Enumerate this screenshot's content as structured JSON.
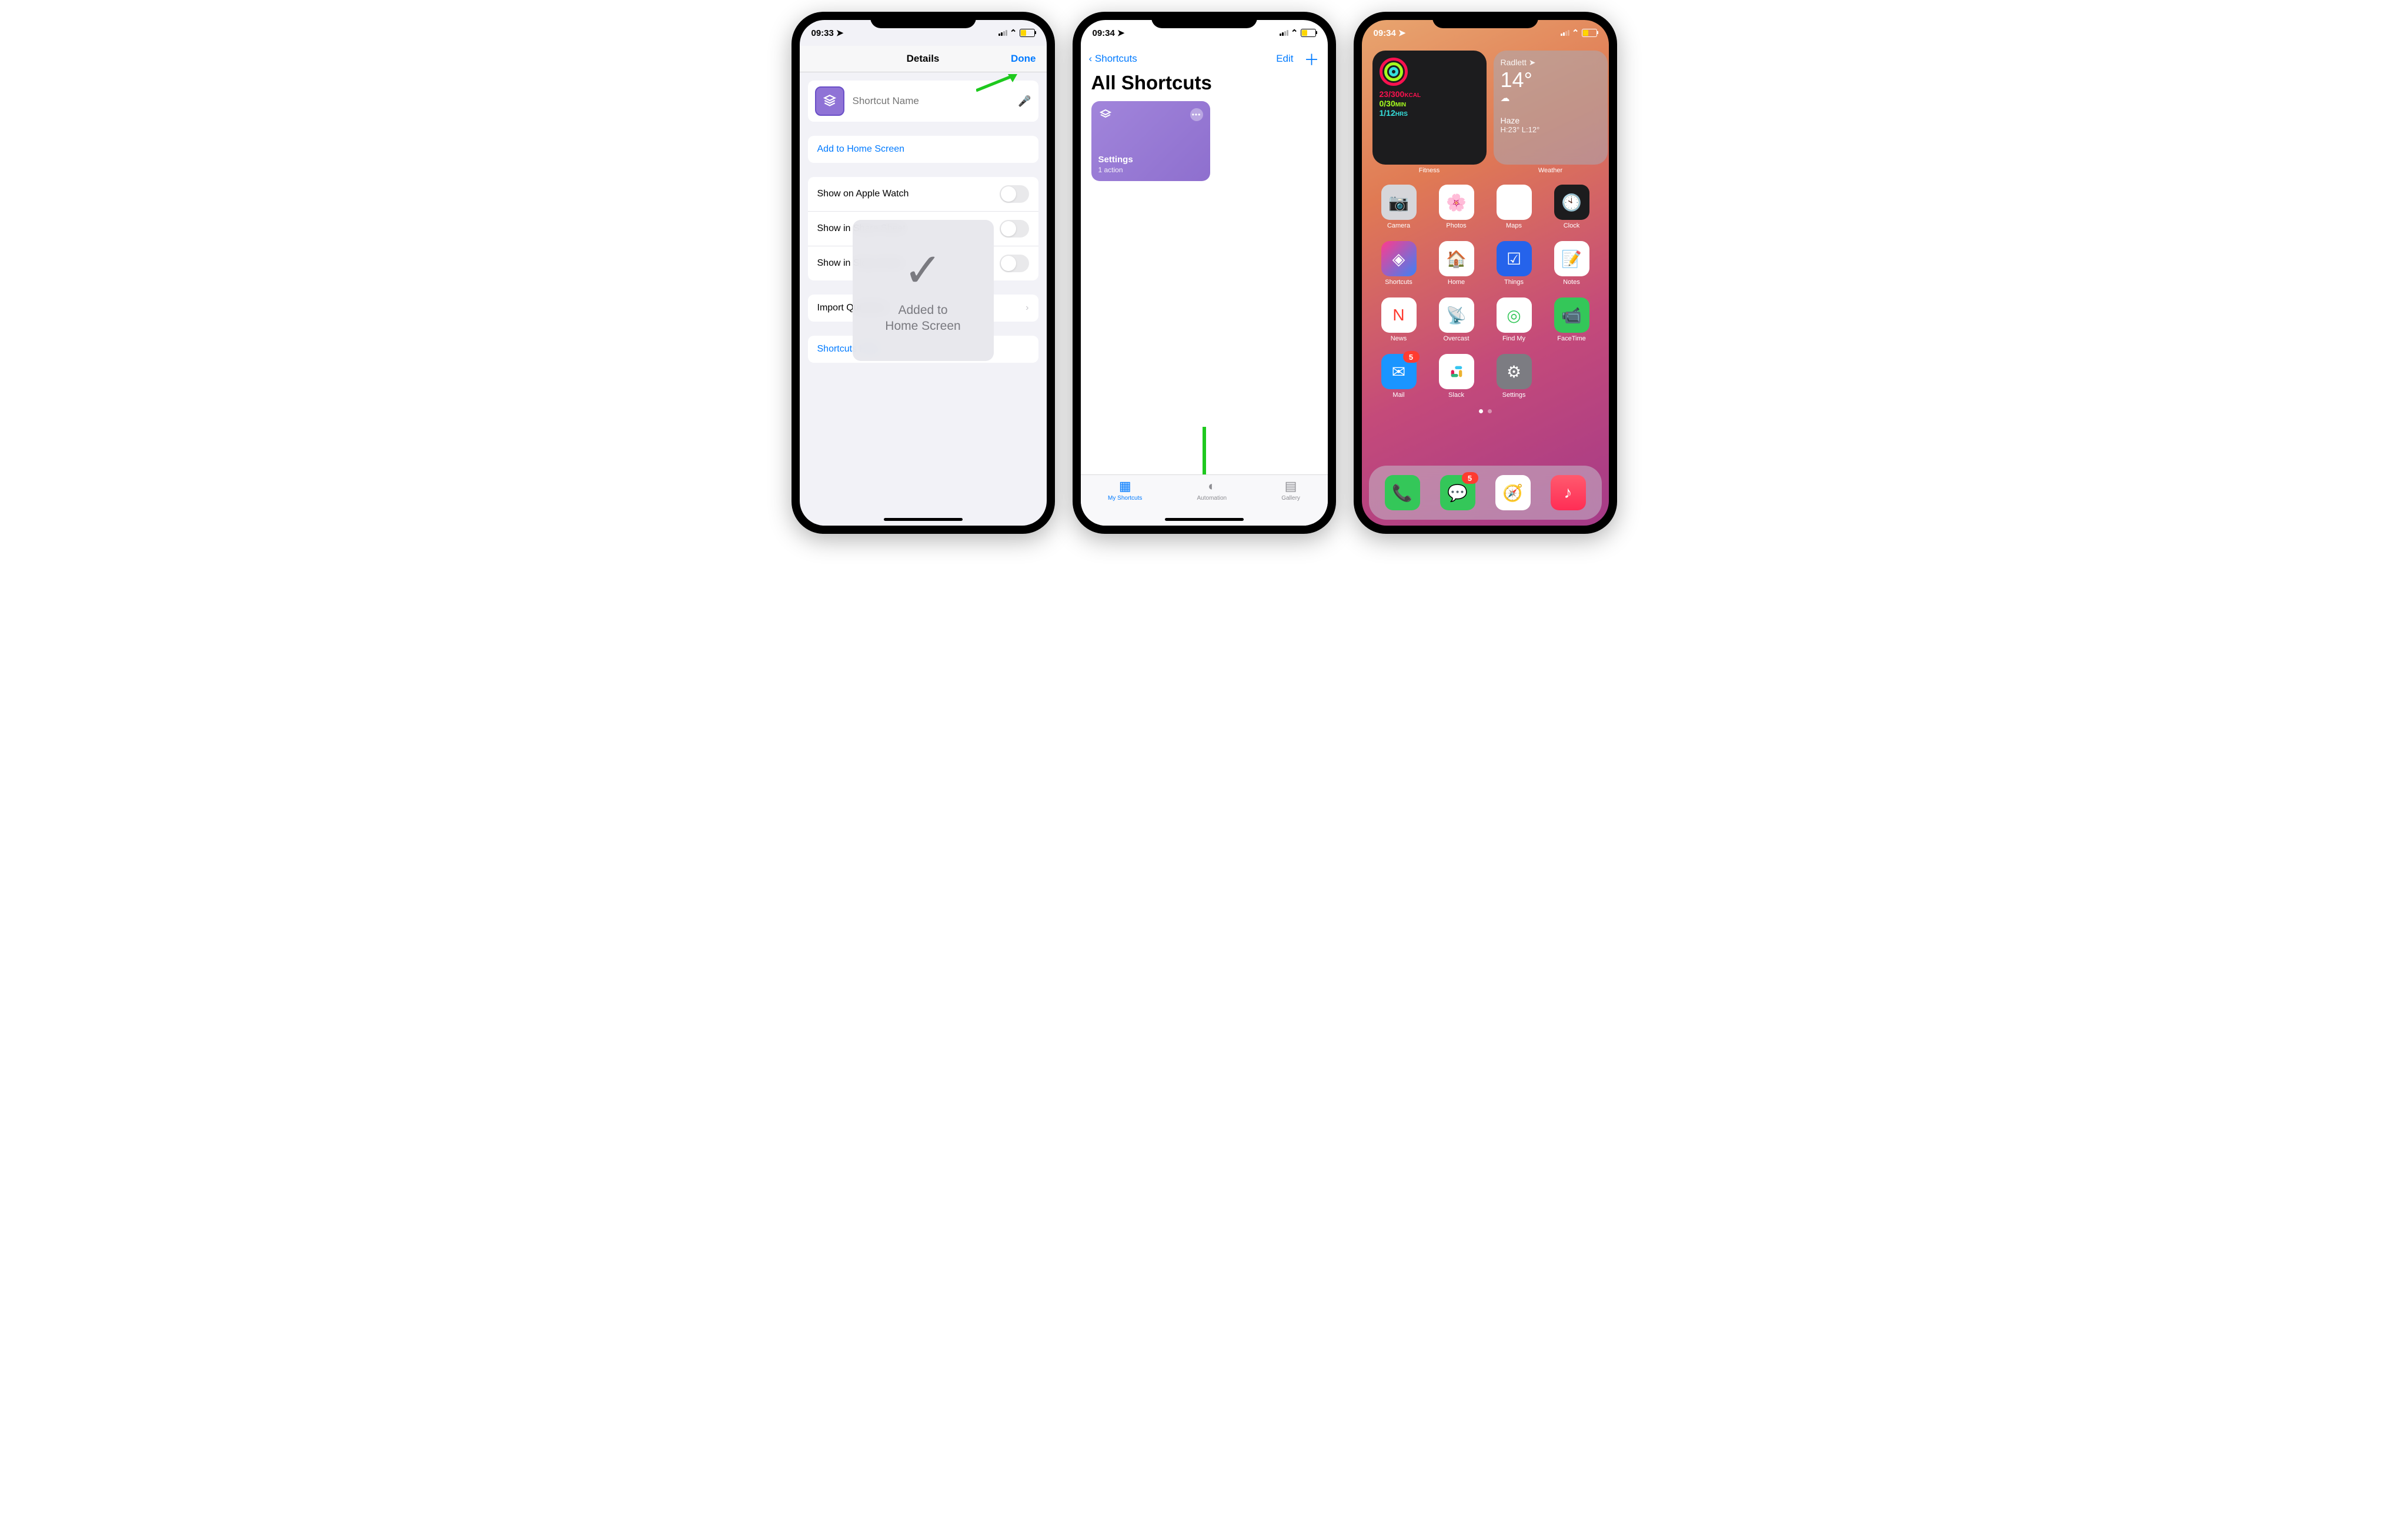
{
  "screen1": {
    "status_time": "09:33",
    "nav_title": "Details",
    "nav_done": "Done",
    "name_placeholder": "Shortcut Name",
    "add_home": "Add to Home Screen",
    "show_watch": "Show on Apple Watch",
    "show_share": "Show in Share Sheet",
    "show_sleep": "Show in Sleep Mode",
    "import_q": "Import Questions",
    "help": "Shortcuts Help",
    "toast_line1": "Added to",
    "toast_line2": "Home Screen"
  },
  "screen2": {
    "status_time": "09:34",
    "back_label": "Shortcuts",
    "edit_label": "Edit",
    "title": "All Shortcuts",
    "card_name": "Settings",
    "card_sub": "1 action",
    "tab_my": "My Shortcuts",
    "tab_auto": "Automation",
    "tab_gallery": "Gallery"
  },
  "screen3": {
    "status_time": "09:34",
    "fitness_label": "Fitness",
    "fitness_l1a": "23/300",
    "fitness_l1b": "KCAL",
    "fitness_l2a": "0/30",
    "fitness_l2b": "MIN",
    "fitness_l3a": "1/12",
    "fitness_l3b": "HRS",
    "weather_label": "Weather",
    "weather_loc": "Radlett",
    "weather_temp": "14°",
    "weather_cond": "Haze",
    "weather_range": "H:23° L:12°",
    "apps_row1": [
      "Camera",
      "Photos",
      "Maps",
      "Clock"
    ],
    "apps_row2": [
      "Shortcuts",
      "Home",
      "Things",
      "Notes"
    ],
    "apps_row3": [
      "News",
      "Overcast",
      "Find My",
      "FaceTime"
    ],
    "apps_row4": [
      "Mail",
      "Slack",
      "Settings"
    ],
    "mail_badge": "5",
    "messages_badge": "5",
    "dock": [
      "Phone",
      "Messages",
      "Safari",
      "Music"
    ]
  }
}
